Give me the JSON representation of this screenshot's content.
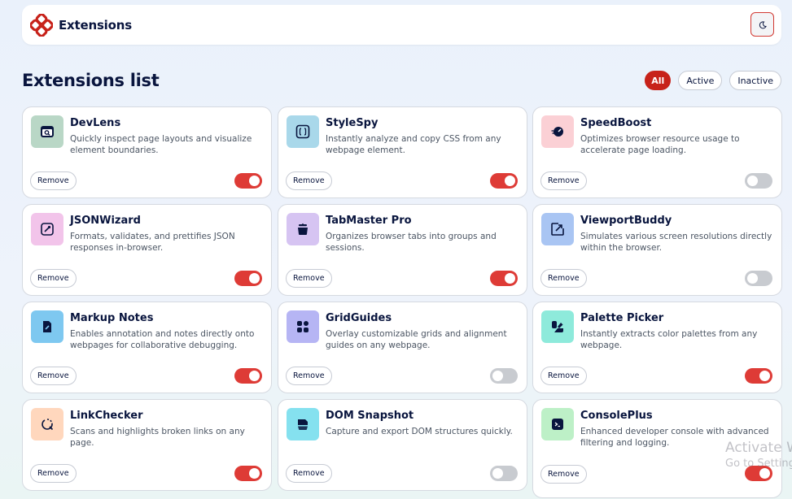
{
  "header": {
    "brand": "Extensions",
    "theme_icon": "moon-icon",
    "logo_icon": "logo-icon",
    "accent": "#c7221a"
  },
  "main": {
    "title": "Extensions list",
    "filters": [
      {
        "label": "All",
        "active": true
      },
      {
        "label": "Active",
        "active": false
      },
      {
        "label": "Inactive",
        "active": false
      }
    ]
  },
  "extensions": [
    {
      "name": "DevLens",
      "description": "Quickly inspect page layouts and visualize element boundaries.",
      "active": true,
      "remove_label": "Remove",
      "icon": "inspect-window-icon",
      "icon_bg": "#b9d7c6"
    },
    {
      "name": "StyleSpy",
      "description": "Instantly analyze and copy CSS from any webpage element.",
      "active": true,
      "remove_label": "Remove",
      "icon": "css-braces-icon",
      "icon_bg": "#a9d8ea"
    },
    {
      "name": "SpeedBoost",
      "description": "Optimizes browser resource usage to accelerate page loading.",
      "active": false,
      "remove_label": "Remove",
      "icon": "speedometer-icon",
      "icon_bg": "#fbd0d5"
    },
    {
      "name": "JSONWizard",
      "description": "Formats, validates, and prettifies JSON responses in-browser.",
      "active": true,
      "remove_label": "Remove",
      "icon": "json-wand-icon",
      "icon_bg": "#f2c4ea"
    },
    {
      "name": "TabMaster Pro",
      "description": "Organizes browser tabs into groups and sessions.",
      "active": true,
      "remove_label": "Remove",
      "icon": "tabs-stack-icon",
      "icon_bg": "#d6c4f2"
    },
    {
      "name": "ViewportBuddy",
      "description": "Simulates various screen resolutions directly within the browser.",
      "active": false,
      "remove_label": "Remove",
      "icon": "viewport-arrow-icon",
      "icon_bg": "#a9c5f3"
    },
    {
      "name": "Markup Notes",
      "description": "Enables annotation and notes directly onto webpages for collaborative debugging.",
      "active": true,
      "remove_label": "Remove",
      "icon": "note-pen-icon",
      "icon_bg": "#7ec8f0"
    },
    {
      "name": "GridGuides",
      "description": "Overlay customizable grids and alignment guides on any webpage.",
      "active": false,
      "remove_label": "Remove",
      "icon": "grid-dots-icon",
      "icon_bg": "#b6b5f4"
    },
    {
      "name": "Palette Picker",
      "description": "Instantly extracts color palettes from any webpage.",
      "active": true,
      "remove_label": "Remove",
      "icon": "palette-icon",
      "icon_bg": "#8eeadb"
    },
    {
      "name": "LinkChecker",
      "description": "Scans and highlights broken links on any page.",
      "active": true,
      "remove_label": "Remove",
      "icon": "broken-link-icon",
      "icon_bg": "#ffd7bd"
    },
    {
      "name": "DOM Snapshot",
      "description": "Capture and export DOM structures quickly.",
      "active": false,
      "remove_label": "Remove",
      "icon": "dom-snapshot-icon",
      "icon_bg": "#85e1ef"
    },
    {
      "name": "ConsolePlus",
      "description": "Enhanced developer console with advanced filtering and logging.",
      "active": true,
      "remove_label": "Remove",
      "icon": "console-prompt-icon",
      "icon_bg": "#bdf0c7"
    }
  ],
  "watermark": {
    "line1": "Activate W",
    "line2": "Go to Setting"
  }
}
